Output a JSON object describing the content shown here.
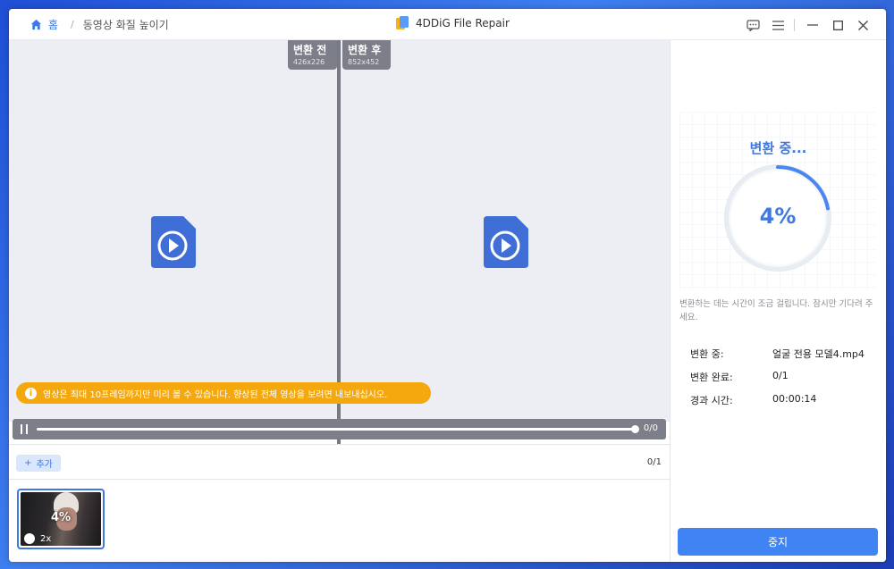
{
  "breadcrumb": {
    "home_label": "홈",
    "separator": "/",
    "current": "동영상 화질 높이기"
  },
  "app": {
    "title": "4DDiG File Repair"
  },
  "window_controls": [
    "feedback-icon",
    "menu-icon",
    "minimize-icon",
    "maximize-icon",
    "close-icon"
  ],
  "preview": {
    "before_label": "변환 전",
    "before_size": "426x226",
    "after_label": "변환 후",
    "after_size": "852x452",
    "notice": "영상은 최대 10프레임까지만 미리 볼 수 있습니다. 향상된 전체 영상을 보려면 내보내십시오.",
    "player_time": "0/0",
    "progress_fraction": 1.0
  },
  "file_bar": {
    "add_label": "추가",
    "count": "0/1"
  },
  "thumbnail": {
    "percent": "4%",
    "scale": "2x"
  },
  "panel": {
    "title": "변환 중...",
    "percent_text": "4%",
    "percent_value": 4,
    "hint": "변환하는 데는 시간이 조금 걸립니다. 잠시만 기다려 주세요.",
    "rows": [
      {
        "label": "변환 중:",
        "value": "얼굴 전용 모델4.mp4"
      },
      {
        "label": "변환 완료:",
        "value": "0/1"
      },
      {
        "label": "경과 시간:",
        "value": "00:00:14"
      }
    ],
    "stop_label": "중지"
  },
  "colors": {
    "accent": "#3f78e0",
    "notice": "#f4a80e",
    "button": "#3f84f2",
    "overlay": "#7c7f8a"
  }
}
